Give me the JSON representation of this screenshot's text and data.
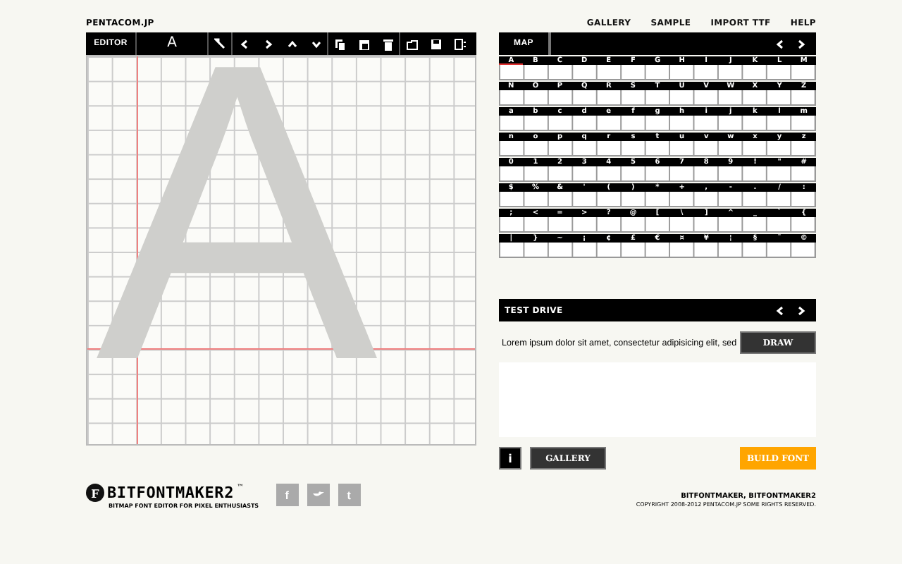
{
  "site": "PENTACOM.JP",
  "nav": [
    "GALLERY",
    "SAMPLE",
    "IMPORT TTF",
    "HELP"
  ],
  "editor": {
    "tab": "EDITOR",
    "glyph": "A",
    "guide_glyph": "A",
    "tools": [
      {
        "kind": "wrench"
      },
      {
        "kind": "left"
      },
      {
        "kind": "right"
      },
      {
        "kind": "up"
      },
      {
        "kind": "down"
      },
      {
        "kind": "copy"
      },
      {
        "kind": "paste"
      },
      {
        "kind": "trash"
      },
      {
        "kind": "open"
      },
      {
        "kind": "save"
      },
      {
        "kind": "export"
      }
    ]
  },
  "map": {
    "title": "MAP",
    "selected_row": [
      {
        "char": "A",
        "selected": true
      },
      {
        "char": "B",
        "selected": false
      },
      {
        "char": "C",
        "selected": false
      },
      {
        "char": "D",
        "selected": false
      },
      {
        "char": "E",
        "selected": false
      },
      {
        "char": "F",
        "selected": false
      },
      {
        "char": "G",
        "selected": false
      },
      {
        "char": "H",
        "selected": false
      },
      {
        "char": "I",
        "selected": false
      },
      {
        "char": "J",
        "selected": false
      },
      {
        "char": "K",
        "selected": false
      },
      {
        "char": "L",
        "selected": false
      },
      {
        "char": "M",
        "selected": false
      }
    ],
    "rows": [
      [
        "N",
        "O",
        "P",
        "Q",
        "R",
        "S",
        "T",
        "U",
        "V",
        "W",
        "X",
        "Y",
        "Z"
      ],
      [
        "a",
        "b",
        "c",
        "d",
        "e",
        "f",
        "g",
        "h",
        "i",
        "j",
        "k",
        "l",
        "m"
      ],
      [
        "n",
        "o",
        "p",
        "q",
        "r",
        "s",
        "t",
        "u",
        "v",
        "w",
        "x",
        "y",
        "z"
      ],
      [
        "0",
        "1",
        "2",
        "3",
        "4",
        "5",
        "6",
        "7",
        "8",
        "9",
        "!",
        "\"",
        "#"
      ],
      [
        "$",
        "%",
        "&",
        "'",
        "(",
        ")",
        "*",
        "+",
        ",",
        "-",
        ".",
        "/",
        ":"
      ],
      [
        ";",
        "<",
        "=",
        ">",
        "?",
        "@",
        "[",
        "\\",
        "]",
        "^",
        "_",
        "`",
        "{"
      ],
      [
        "|",
        "}",
        "~",
        "¡",
        "¢",
        "£",
        "€",
        "¤",
        "¥",
        "¦",
        "§",
        "¨",
        "©"
      ]
    ]
  },
  "test_drive": {
    "title": "TEST DRIVE",
    "text": "Lorem ipsum dolor sit amet, consectetur adipisicing elit, sed",
    "draw": "DRAW",
    "info": "i",
    "gallery": "GALLERY",
    "build": "BUILD FONT"
  },
  "footer": {
    "logo_mark": "F",
    "logo": "BITFONTMAKER2",
    "tm": "™",
    "tagline": "BITMAP FONT EDITOR FOR PIXEL ENTHUSIASTS",
    "social": [
      {
        "kind": "letter",
        "text": "f"
      },
      {
        "kind": "bird"
      },
      {
        "kind": "letter",
        "text": "t"
      }
    ],
    "credits": "BITFONTMAKER, BITFONTMAKER2",
    "copyright": "COPYRIGHT 2008-2012 PENTACOM.JP SOME RIGHTS RESERVED."
  }
}
